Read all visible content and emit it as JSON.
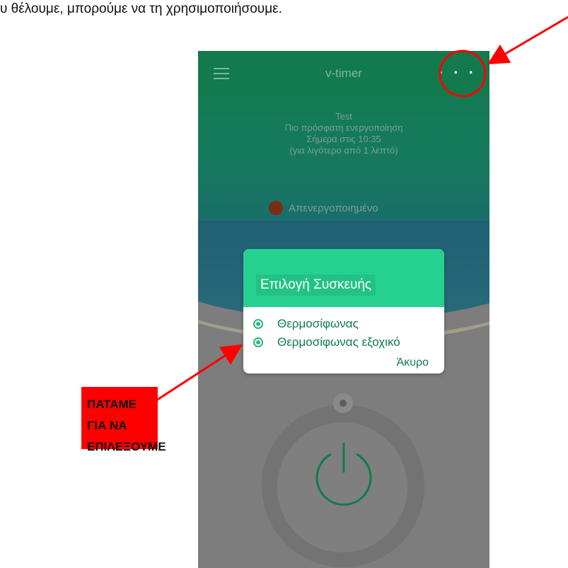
{
  "document": {
    "intro_text": "υ θέλουμε, μπορούμε να τη χρησιμοποιήσουμε."
  },
  "app": {
    "title": "v-timer",
    "more_menu": "· · ·",
    "status": {
      "device": "Test",
      "line1": "Πιο πρόσφατη ενεργοποίηση",
      "line2": "Σήμερα στις 10:35",
      "line3": "(για λιγότερο από 1 λεπτό)",
      "state": "Απενεργοποιημένο"
    }
  },
  "dialog": {
    "title": "Επιλογή Συσκευής",
    "options": [
      "Θερμοσίφωνας",
      "Θερμοσίφωνας εξοχικό"
    ],
    "cancel_label": "Άκυρο"
  },
  "annotation": {
    "callout_line1": "ΠΑΤΑΜΕ ΓΙΑ ΝΑ",
    "callout_line2": "ΕΠΙΛΕΞΟΥΜΕ"
  },
  "colors": {
    "toolbar": "#127a4d",
    "dialog_header": "#26d190",
    "accent_text": "#0e7a4d",
    "annotation_red": "#ff0000",
    "status_dot": "#7a2b16"
  },
  "icons": [
    "hamburger-icon",
    "more-dots-icon",
    "power-icon",
    "radio-icon"
  ]
}
